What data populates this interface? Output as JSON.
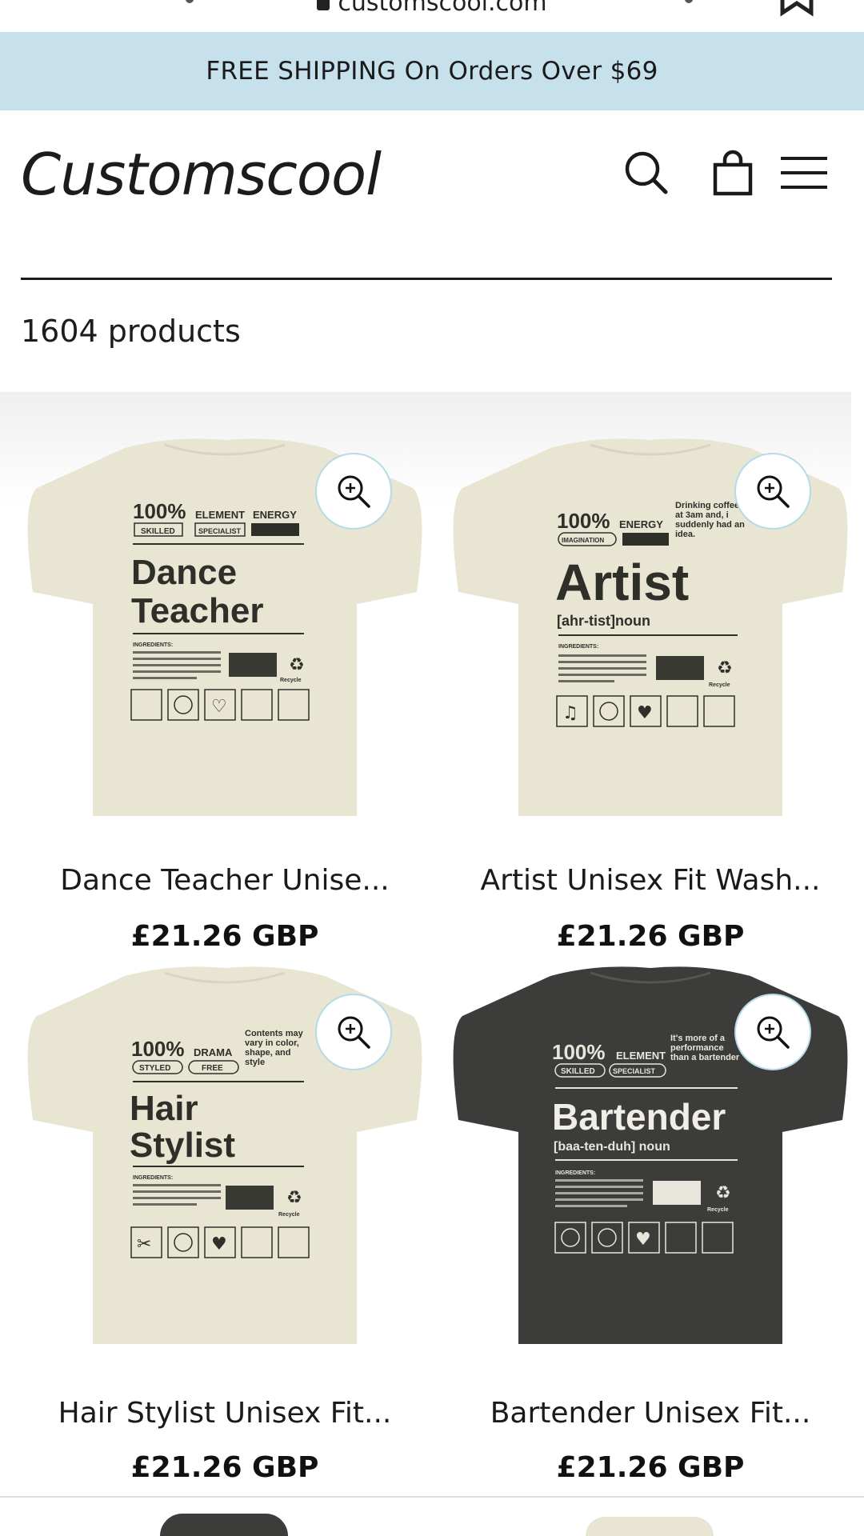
{
  "browser": {
    "url": "customscool.com"
  },
  "announcement": {
    "text": "FREE SHIPPING On Orders Over $69"
  },
  "header": {
    "logo": "Customscool",
    "icons": [
      "search-icon",
      "bag-icon",
      "menu-icon"
    ]
  },
  "collection": {
    "count_text": "1604 products"
  },
  "colors": {
    "announce_bg": "#c6e1ec",
    "zoom_border": "#b6dbe8",
    "shirt_cream": "#e8e5d3",
    "shirt_charcoal": "#3c3d3a"
  },
  "products": [
    {
      "title": "Dance Teacher Unise...",
      "price": "£21.26 GBP",
      "shirt": {
        "percent": "100%",
        "tag1": "ELEMENT",
        "tag2": "ENERGY",
        "pill1": "SKILLED",
        "pill2": "SPECIALIST",
        "name1": "Dance",
        "name2": "Teacher",
        "ingredients": "INGREDIENTS:",
        "recycle": "Recycle"
      }
    },
    {
      "title": "Artist Unisex Fit Wash...",
      "price": "£21.26 GBP",
      "shirt": {
        "percent": "100%",
        "tag1": "ENERGY",
        "pill1": "IMAGINATION",
        "side": "Drinking coffee at 3am and, i suddenly had an idea.",
        "name1": "Artist",
        "pron": "[ahr-tist]noun",
        "ingredients": "INGREDIENTS:",
        "recycle": "Recycle"
      }
    },
    {
      "title": "Hair Stylist Unisex Fit...",
      "price": "£21.26 GBP",
      "shirt": {
        "percent": "100%",
        "tag1": "DRAMA",
        "pill1": "STYLED",
        "pill2": "FREE",
        "side": "Contents may vary in color, shape, and style",
        "name1": "Hair",
        "name2": "Stylist",
        "ingredients": "INGREDIENTS:",
        "recycle": "Recycle"
      }
    },
    {
      "title": "Bartender Unisex Fit...",
      "price": "£21.26 GBP",
      "shirt": {
        "percent": "100%",
        "tag1": "ELEMENT",
        "pill1": "SKILLED",
        "pill2": "SPECIALIST",
        "side": "It's more of a performance than a bartender",
        "name1": "Bartender",
        "pron": "[baa-ten-duh] noun",
        "ingredients": "INGREDIENTS:",
        "recycle": "Recycle"
      }
    }
  ]
}
